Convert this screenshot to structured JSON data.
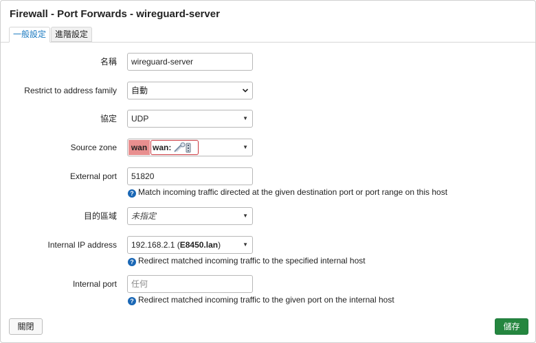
{
  "dialog": {
    "title": "Firewall - Port Forwards - wireguard-server"
  },
  "tabs": [
    {
      "label": "一般設定",
      "active": true
    },
    {
      "label": "進階設定",
      "active": false
    }
  ],
  "form": {
    "name": {
      "label": "名稱",
      "value": "wireguard-server"
    },
    "family": {
      "label": "Restrict to address family",
      "value": "自動"
    },
    "protocol": {
      "label": "協定",
      "value": "UDP"
    },
    "source_zone": {
      "label": "Source zone",
      "badge": "wan",
      "chip": "wan:"
    },
    "external_port": {
      "label": "External port",
      "value": "51820",
      "hint": "Match incoming traffic directed at the given destination port or port range on this host"
    },
    "dest_zone": {
      "label": "目的區域",
      "value": "未指定"
    },
    "internal_ip": {
      "label": "Internal IP address",
      "value_prefix": "192.168.2.1 (",
      "value_bold": "E8450.lan",
      "value_suffix": ")",
      "hint": "Redirect matched incoming traffic to the specified internal host"
    },
    "internal_port": {
      "label": "Internal port",
      "placeholder": "任何",
      "hint": "Redirect matched incoming traffic to the given port on the internal host"
    }
  },
  "footer": {
    "close_label": "關閉",
    "save_label": "儲存"
  },
  "icons": {
    "help": "question-circle-icon",
    "dropdown": "caret-down-icon"
  },
  "colors": {
    "tab_active": "#1a79c0",
    "zone_wan": "#e88f8f",
    "save_button": "#25863f",
    "help_icon": "#1a67b5"
  }
}
